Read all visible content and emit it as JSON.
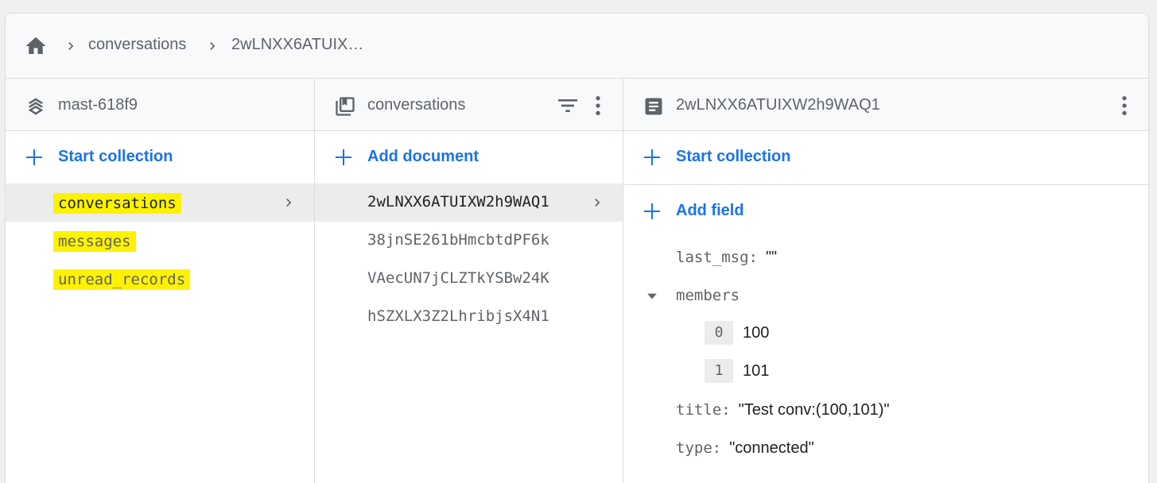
{
  "breadcrumb": {
    "home_icon": "home-icon",
    "items": [
      "conversations",
      "2wLNXX6ATUIX…"
    ]
  },
  "project_panel": {
    "icon": "firestore-stack-icon",
    "title": "mast-618f9",
    "action_label": "Start collection",
    "collections": [
      "conversations",
      "messages",
      "unread_records"
    ],
    "selected_index": 0
  },
  "collection_panel": {
    "icon": "collection-icon",
    "title": "conversations",
    "action_label": "Add document",
    "documents": [
      "2wLNXX6ATUIXW2h9WAQ1",
      "38jnSE261bHmcbtdPF6k",
      "VAecUN7jCLZTkYSBw24K",
      "hSZXLX3Z2LhribjsX4N1"
    ],
    "selected_index": 0
  },
  "document_panel": {
    "icon": "document-icon",
    "title": "2wLNXX6ATUIXW2h9WAQ1",
    "start_collection_label": "Start collection",
    "add_field_label": "Add field",
    "fields": {
      "last_msg": {
        "key": "last_msg:",
        "value": "\"\""
      },
      "members": {
        "key": "members",
        "items": [
          {
            "index": "0",
            "value": "100"
          },
          {
            "index": "1",
            "value": "101"
          }
        ]
      },
      "title": {
        "key": "title:",
        "value": "\"Test conv:(100,101)\""
      },
      "type": {
        "key": "type:",
        "value": "\"connected\""
      }
    }
  },
  "colors": {
    "accent": "#1a73e8",
    "highlight": "#fff200",
    "selected_row": "#ececec",
    "border": "#dadce0"
  }
}
